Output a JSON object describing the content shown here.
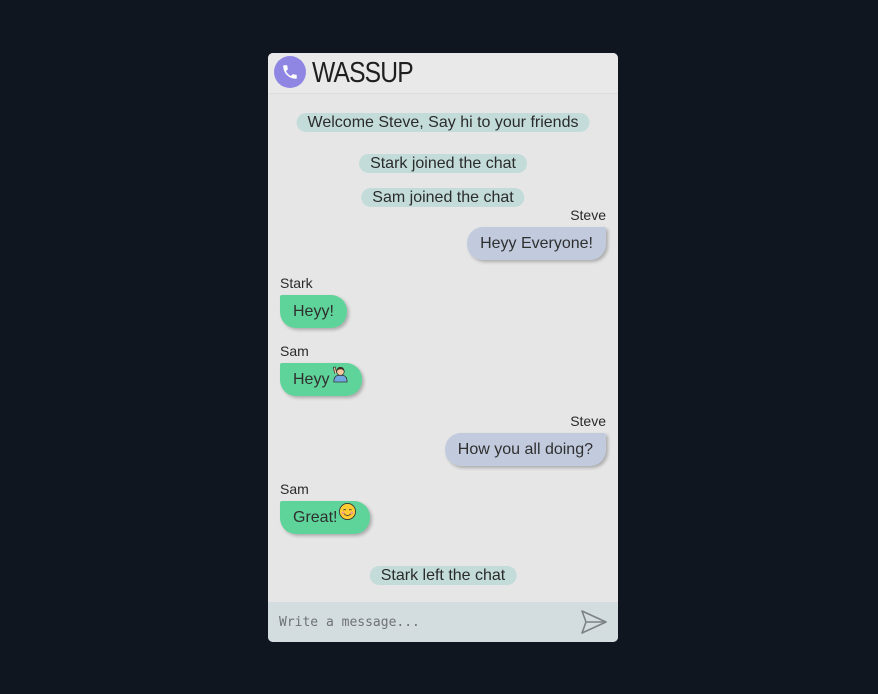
{
  "app": {
    "title": "WASSUP",
    "logo_icon": "phone-icon",
    "logo_color": "#8f86e3"
  },
  "chat": {
    "welcome": "Welcome Steve, Say hi to your friends",
    "events": [
      "Stark joined the chat",
      "Sam joined the chat",
      "Stark left the chat"
    ],
    "messages": [
      {
        "sender": "Steve",
        "text": "Heyy Everyone!",
        "side": "right"
      },
      {
        "sender": "Stark",
        "text": "Heyy!",
        "side": "left"
      },
      {
        "sender": "Sam",
        "text": "Heyy",
        "emoji": "raising-hand-emoji",
        "side": "left"
      },
      {
        "sender": "Steve",
        "text": "How you all doing?",
        "side": "right"
      },
      {
        "sender": "Sam",
        "text": "Great!",
        "emoji": "smiling-face-emoji",
        "side": "left"
      }
    ]
  },
  "composer": {
    "placeholder": "Write a message...",
    "send_icon": "send-icon"
  },
  "colors": {
    "background": "#0f161f",
    "own_bubble": "#c2cbde",
    "other_bubble": "#5fd49a",
    "system_bubble": "#c3dcda",
    "composer": "#d3dcdf"
  }
}
